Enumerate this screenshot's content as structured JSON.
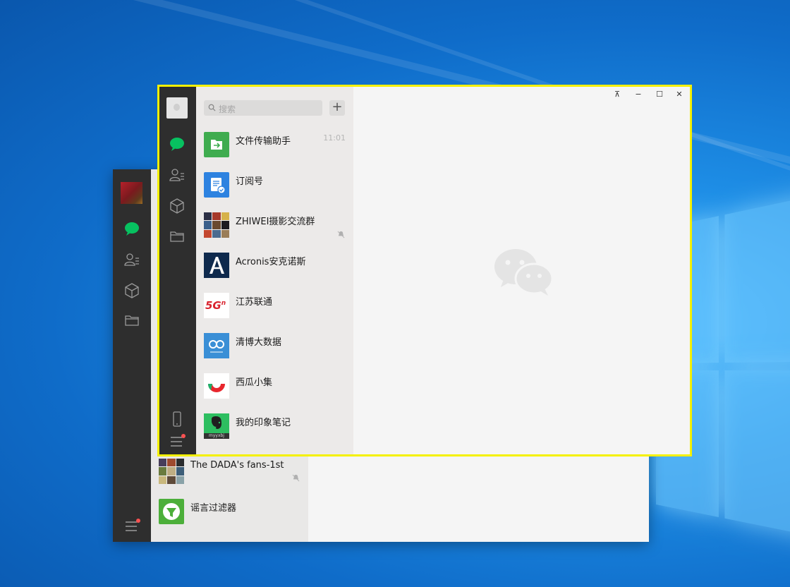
{
  "search": {
    "placeholder": "搜索"
  },
  "chats": [
    {
      "name": "文件传输助手",
      "time": "11:01"
    },
    {
      "name": "订阅号",
      "time": ""
    },
    {
      "name": "ZHIWEI摄影交流群",
      "time": ""
    },
    {
      "name": "Acronis安克诺斯",
      "time": ""
    },
    {
      "name": "江苏联通",
      "time": ""
    },
    {
      "name": "清博大数据",
      "time": ""
    },
    {
      "name": "西瓜小集",
      "time": ""
    },
    {
      "name": "我的印象笔记",
      "time": ""
    }
  ],
  "back_chats": [
    {
      "name": "The DADA's fans-1st"
    },
    {
      "name": "谣言过滤器"
    }
  ],
  "window_controls": {
    "pin": "⊼",
    "minimize": "−",
    "maximize": "☐",
    "close": "✕"
  },
  "thumbnail_text": {
    "five_g": "5G",
    "five_g_sup": "n",
    "evernote_tag": "myyxbj"
  },
  "colors": {
    "wechat_green": "#07c160",
    "sidebar": "#2e2e2e",
    "highlight_border": "#f4f000",
    "notification_dot": "#fa5151"
  }
}
